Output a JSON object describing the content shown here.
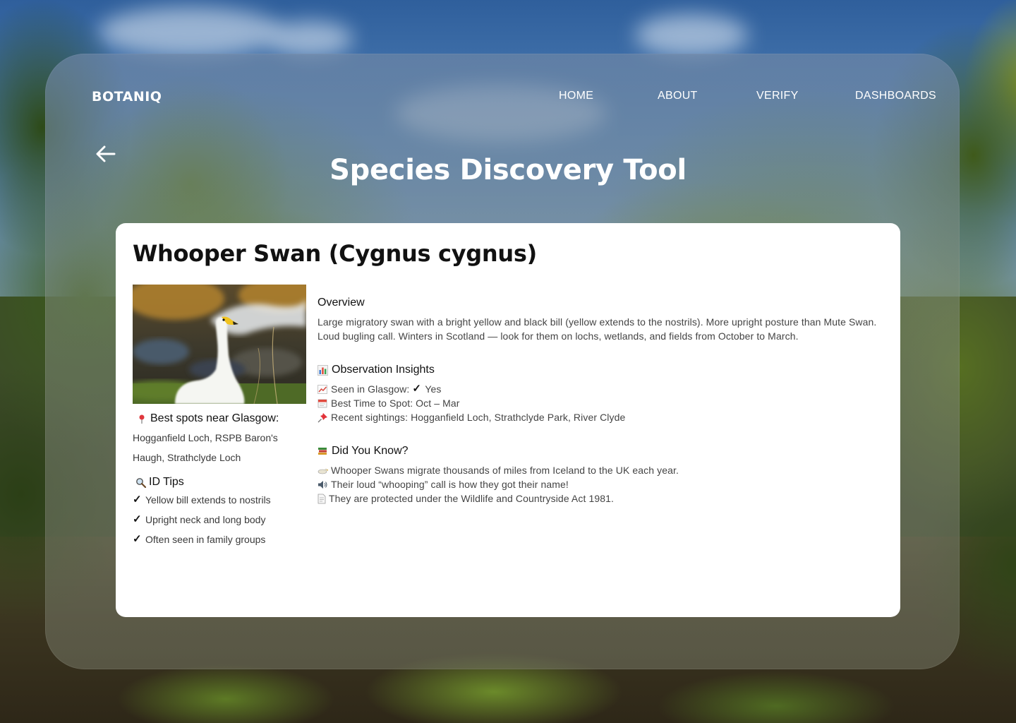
{
  "header": {
    "logo": "BOTANIQ",
    "nav": [
      {
        "label": "HOME"
      },
      {
        "label": "ABOUT"
      },
      {
        "label": "VERIFY"
      },
      {
        "label": "DASHBOARDS"
      }
    ],
    "page_title": "Species Discovery Tool"
  },
  "species": {
    "title": "Whooper Swan (Cygnus cygnus)",
    "spots": {
      "heading": "Best spots near Glasgow:",
      "line1": "Hogganfield Loch, RSPB Baron's",
      "line2": "Haugh, Strathclyde Loch"
    },
    "id_tips": {
      "heading": "ID Tips",
      "items": [
        "Yellow bill extends to nostrils",
        "Upright neck and long body",
        "Often seen in family groups"
      ]
    },
    "overview": {
      "heading": "Overview",
      "text": "Large migratory swan with a bright yellow and black bill (yellow extends to the nostrils). More upright posture than Mute Swan. Loud bugling call. Winters in Scotland — look for them on lochs, wetlands, and fields from October to March."
    },
    "insights": {
      "heading": "Observation Insights",
      "seen_label": "Seen in Glasgow:",
      "seen_value": "Yes",
      "best_time": "Best Time to Spot: Oct – Mar",
      "recent": "Recent sightings: Hogganfield Loch, Strathclyde Park, River Clyde"
    },
    "did_you_know": {
      "heading": "Did You Know?",
      "facts": [
        "Whooper Swans migrate thousands of miles from Iceland to the UK each year.",
        "Their loud “whooping” call is how they got their name!",
        "They are protected under the Wildlife and Countryside Act 1981."
      ]
    }
  },
  "icons": {
    "back": "arrow-left-icon",
    "pin": "round-pushpin-icon",
    "magnifier": "magnifier-icon",
    "chart": "bar-chart-icon",
    "trend": "trend-chart-icon",
    "calendar": "calendar-icon",
    "pushpin": "pushpin-icon",
    "books": "books-icon",
    "bird": "bird-icon",
    "speaker": "speaker-icon",
    "document": "document-icon"
  },
  "colors": {
    "card_bg": "#ffffff",
    "title_text": "#111111",
    "nav_text": "#ffffff"
  }
}
